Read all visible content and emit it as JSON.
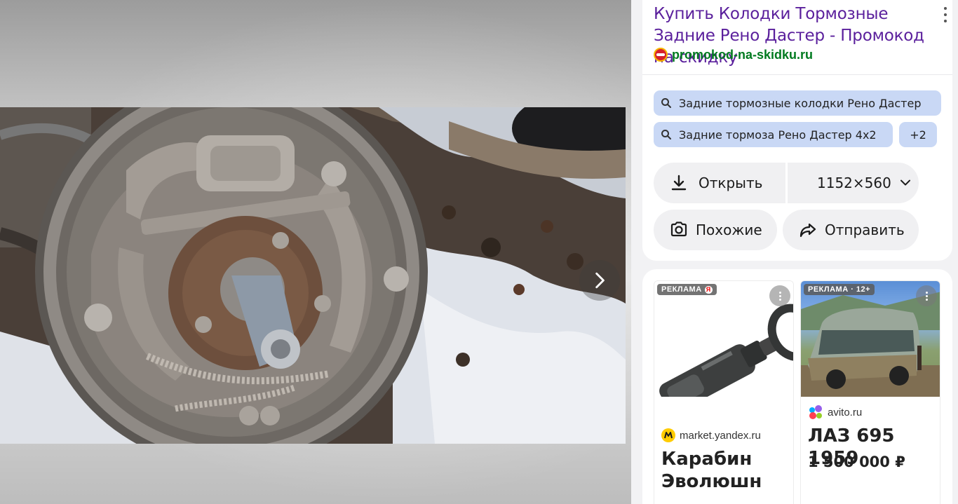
{
  "result": {
    "title": "Купить Колодки Тормозные Задние Рено Дастер - Промокод на скидку",
    "source": "promokod-na-skidku.ru"
  },
  "related_queries": [
    "Задние тормозные колодки Рено Дастер",
    "Задние тормоза Рено Дастер 4x2"
  ],
  "more_queries_label": "+2",
  "actions": {
    "open_label": "Открыть",
    "size_label": "1152×560",
    "similar_label": "Похожие",
    "share_label": "Отправить"
  },
  "ads": [
    {
      "badge": "РЕКЛАМА",
      "source": "market.yandex.ru",
      "title": "Карабин Эволюшн"
    },
    {
      "badge": "РЕКЛАМА · 12+",
      "source": "avito.ru",
      "title": "ЛАЗ 695 1959",
      "price": "1 500 000 ₽"
    }
  ],
  "icons": {
    "next": "chevron-right-icon",
    "search": "search-icon",
    "download": "download-icon",
    "dropdown": "chevron-down-icon",
    "similar": "camera-lens-icon",
    "share": "share-arrow-icon",
    "menu": "more-vertical-icon"
  },
  "colors": {
    "title": "#5a1f9c",
    "source": "#007a1f",
    "chip_bg": "#c9d8f5",
    "button_bg": "#f0f0f2"
  }
}
